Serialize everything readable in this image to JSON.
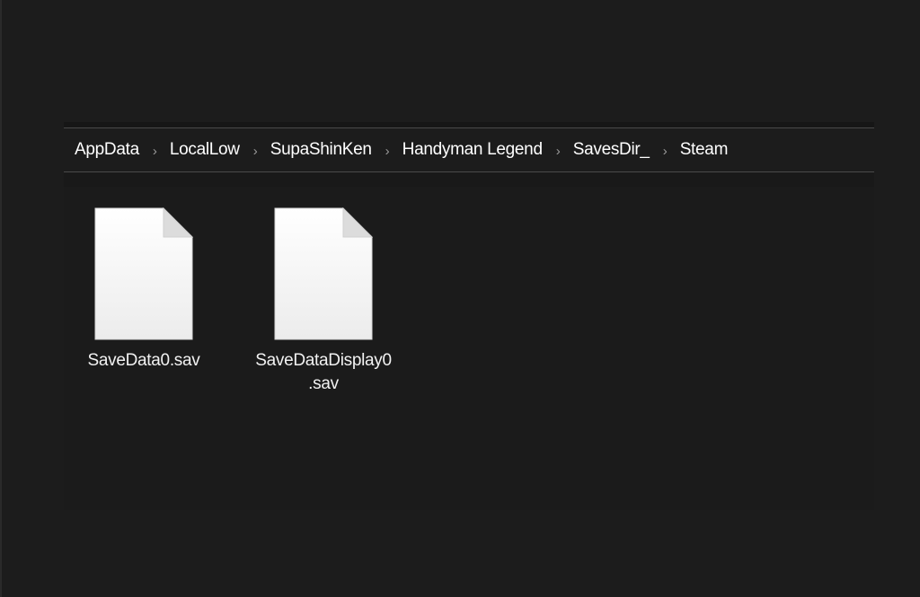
{
  "breadcrumb": [
    {
      "label": "AppData"
    },
    {
      "label": "LocalLow"
    },
    {
      "label": "SupaShinKen"
    },
    {
      "label": "Handyman Legend"
    },
    {
      "label": "SavesDir_"
    },
    {
      "label": "Steam"
    }
  ],
  "separator_glyph": "›",
  "files": [
    {
      "name_line1": "SaveData0.sav",
      "name_line2": "",
      "icon": "file-icon"
    },
    {
      "name_line1": "SaveDataDisplay0",
      "name_line2": ".sav",
      "icon": "file-icon"
    }
  ]
}
